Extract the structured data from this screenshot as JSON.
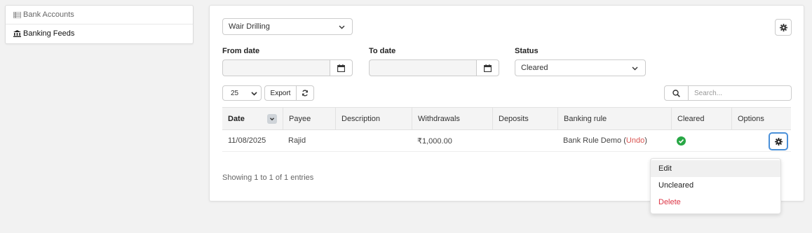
{
  "sidebar": {
    "items": [
      {
        "label": "Bank Accounts",
        "icon": "list-icon"
      },
      {
        "label": "Banking Feeds",
        "icon": "bank-icon"
      }
    ]
  },
  "filters": {
    "account_selected": "Wair Drilling",
    "from_date_label": "From date",
    "to_date_label": "To date",
    "status_label": "Status",
    "status_selected": "Cleared"
  },
  "toolbar": {
    "page_length": "25",
    "export_label": "Export",
    "search_placeholder": "Search..."
  },
  "table": {
    "headers": [
      "Date",
      "Payee",
      "Description",
      "Withdrawals",
      "Deposits",
      "Banking rule",
      "Cleared",
      "Options"
    ],
    "rows": [
      {
        "date": "11/08/2025",
        "payee": "Rajid",
        "description": "",
        "withdrawals": "₹1,000.00",
        "deposits": "",
        "banking_rule": "Bank Rule Demo",
        "undo_label": "Undo",
        "cleared": true
      }
    ],
    "info": "Showing 1 to 1 of 1 entries"
  },
  "options_menu": {
    "items": [
      "Edit",
      "Uncleared",
      "Delete"
    ]
  },
  "colors": {
    "accent": "#4a90d9",
    "success": "#28a745",
    "danger": "#dc3545"
  }
}
